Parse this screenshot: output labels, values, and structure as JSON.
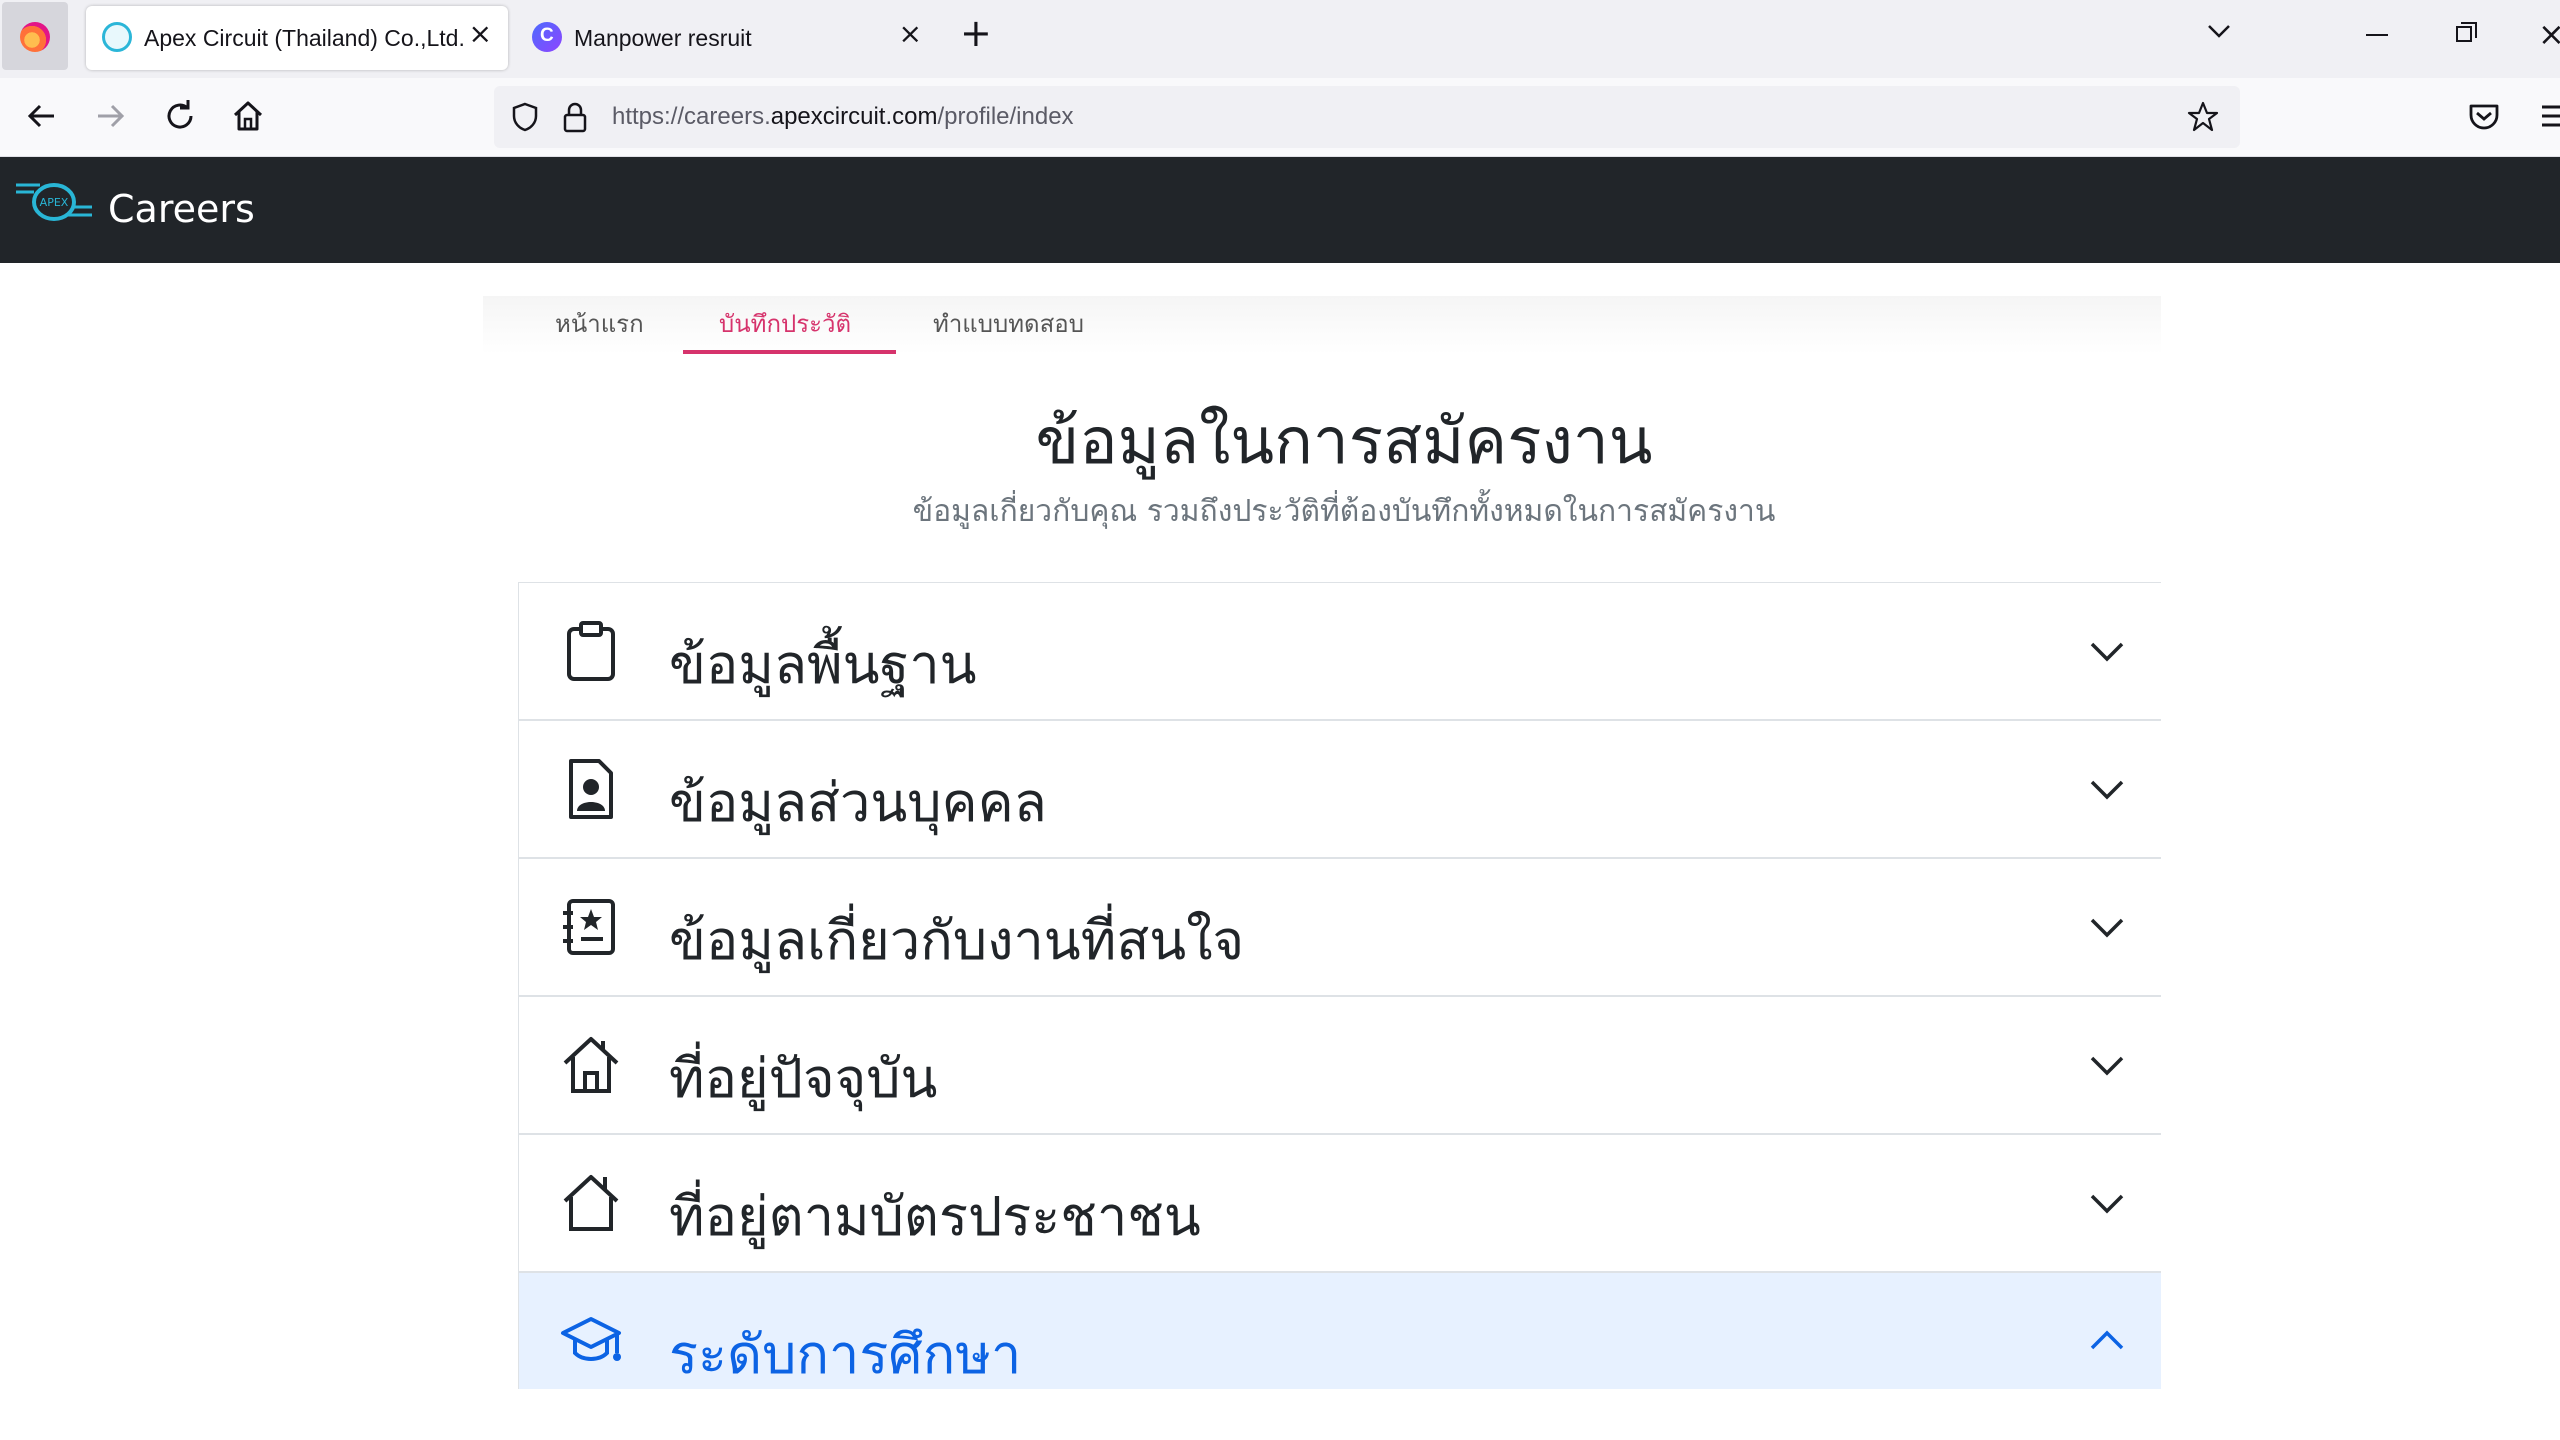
{
  "browser": {
    "tabs": [
      {
        "title": "Apex Circuit (Thailand) Co.,Ltd.",
        "active": true
      },
      {
        "title": "Manpower resruit",
        "active": false
      }
    ],
    "url": {
      "prefix": "https://careers.",
      "domain": "apexcircuit.com",
      "path": "/profile/index"
    }
  },
  "site": {
    "brand": "Careers",
    "nav": [
      {
        "label": "หน้าแรก",
        "active": false
      },
      {
        "label": "บันทึกประวัติ",
        "active": true
      },
      {
        "label": "ทำแบบทดสอบ",
        "active": false
      }
    ]
  },
  "page": {
    "title": "ข้อมูลในการสมัครงาน",
    "subtitle": "ข้อมูลเกี่ยวกับคุณ รวมถึงประวัติที่ต้องบันทึกทั้งหมดในการสมัครงาน"
  },
  "accordion": [
    {
      "label": "ข้อมูลพื้นฐาน",
      "icon": "clipboard-icon",
      "expanded": false
    },
    {
      "label": "ข้อมูลส่วนบุคคล",
      "icon": "person-badge-icon",
      "expanded": false
    },
    {
      "label": "ข้อมูลเกี่ยวกับงานที่สนใจ",
      "icon": "journal-bookmark-icon",
      "expanded": false
    },
    {
      "label": "ที่อยู่ปัจจุบัน",
      "icon": "house-door-icon",
      "expanded": false
    },
    {
      "label": "ที่อยู่ตามบัตรประชาชน",
      "icon": "house-outline-icon",
      "expanded": false
    },
    {
      "label": "ระดับการศึกษา",
      "icon": "mortarboard-icon",
      "expanded": true
    }
  ],
  "colors": {
    "header_bg": "#212529",
    "accent_pink": "#d6336c",
    "open_bg": "#e7f1ff",
    "open_text": "#0c63e4"
  }
}
